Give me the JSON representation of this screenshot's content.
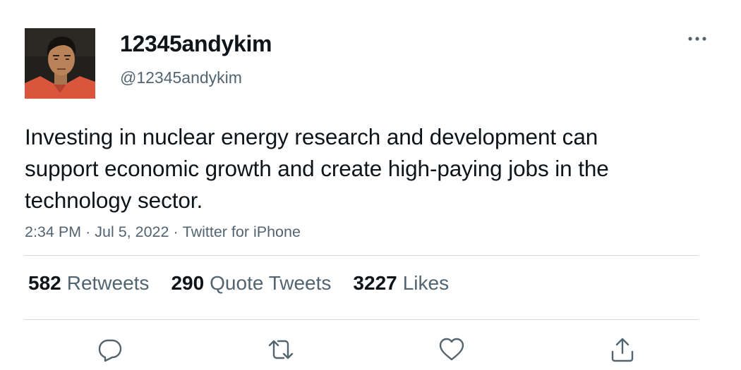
{
  "user": {
    "display_name": "12345andykim",
    "handle": "@12345andykim"
  },
  "tweet": {
    "text": "Investing in nuclear energy research and development can support economic growth and create high-paying jobs in the technology sector.",
    "time": "2:34 PM",
    "date": "Jul 5, 2022",
    "separator": "·",
    "source": "Twitter for iPhone"
  },
  "stats": {
    "retweets": {
      "count": "582",
      "label": "Retweets"
    },
    "quotes": {
      "count": "290",
      "label": "Quote Tweets"
    },
    "likes": {
      "count": "3227",
      "label": "Likes"
    }
  },
  "icons": {
    "more": "more-horizontal-icon",
    "reply": "reply-icon",
    "retweet": "retweet-icon",
    "like": "heart-icon",
    "share": "share-icon"
  },
  "colors": {
    "text": "#0f1419",
    "secondary": "#536471",
    "divider": "#cfd9de",
    "icon": "#536471"
  }
}
